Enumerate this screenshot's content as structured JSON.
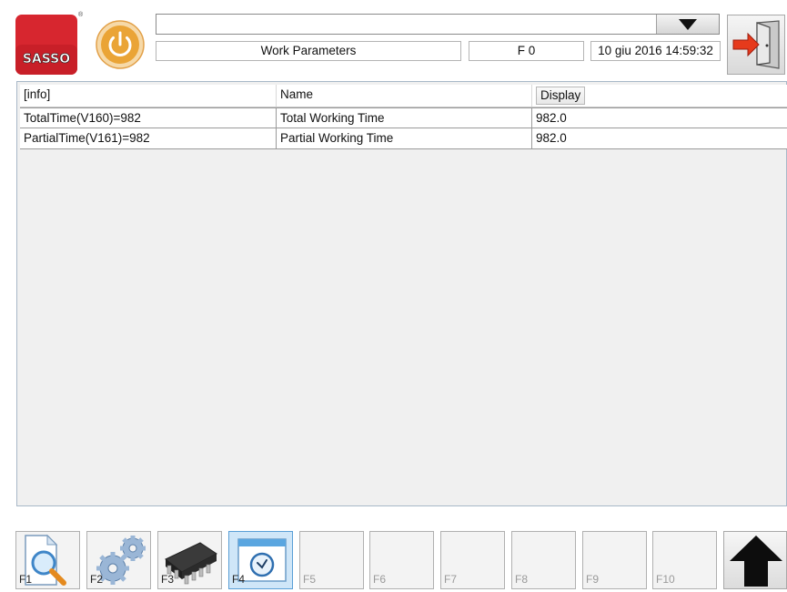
{
  "header": {
    "brand": "SASSO",
    "brand_mark": "®",
    "dropdown_value": "",
    "title": "Work Parameters",
    "code": "F 0",
    "datetime": "10 giu 2016 14:59:32"
  },
  "icons": {
    "power": "power-icon",
    "exit": "exit-door-icon",
    "dropdown": "triangle-down-icon",
    "up": "up-arrow-icon"
  },
  "table": {
    "columns": [
      "[info]",
      "Name",
      "Display"
    ],
    "rows": [
      [
        "TotalTime(V160)=982",
        "Total Working Time",
        "982.0"
      ],
      [
        "PartialTime(V161)=982",
        "Partial Working Time",
        "982.0"
      ]
    ]
  },
  "function_keys": [
    {
      "label": "F1",
      "icon": "document-search-icon"
    },
    {
      "label": "F2",
      "icon": "gears-icon"
    },
    {
      "label": "F3",
      "icon": "chip-icon"
    },
    {
      "label": "F4",
      "icon": "clock-window-icon",
      "active": true
    },
    {
      "label": "F5"
    },
    {
      "label": "F6"
    },
    {
      "label": "F7"
    },
    {
      "label": "F8"
    },
    {
      "label": "F9"
    },
    {
      "label": "F10"
    }
  ],
  "colors": {
    "brand_red": "#d7262f",
    "power_orange": "#eaa436",
    "active_key": "#cfe6f8"
  }
}
